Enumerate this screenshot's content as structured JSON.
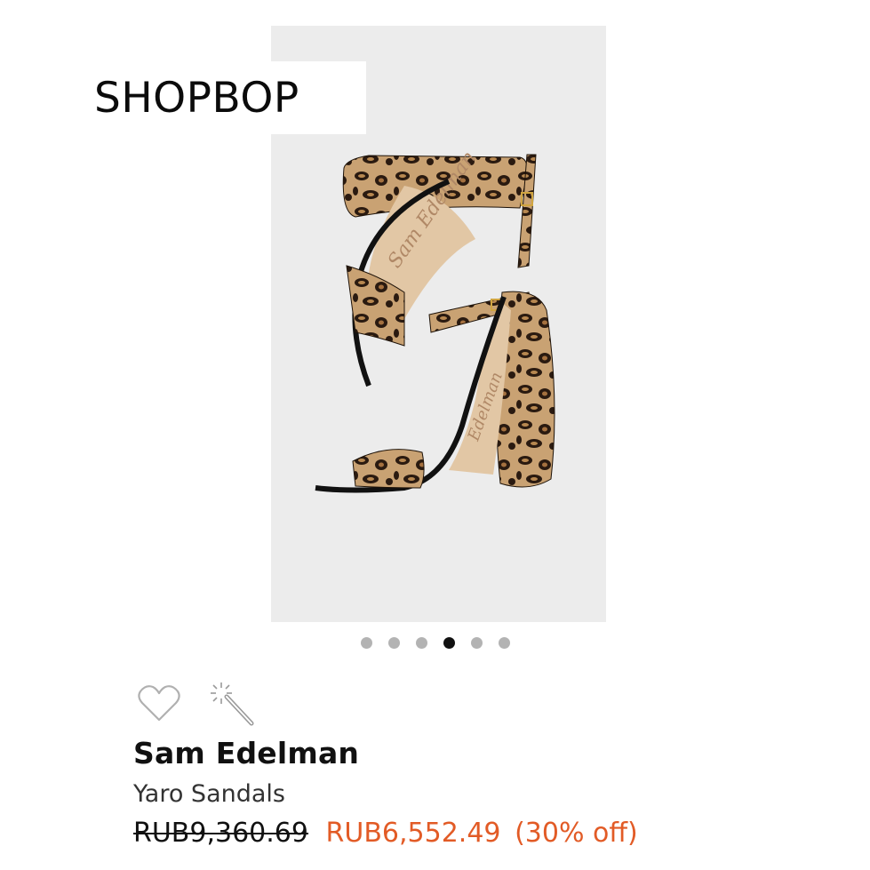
{
  "logo": "SHOPBOP",
  "gallery": {
    "dot_count": 6,
    "active_index": 3
  },
  "actions": {
    "favorite_icon": "heart-outline-icon",
    "tryon_icon": "magic-wand-icon"
  },
  "product": {
    "brand": "Sam Edelman",
    "name": "Yaro Sandals",
    "original_price": "RUB9,360.69",
    "sale_price": "RUB6,552.49",
    "discount": "(30% off)"
  },
  "colors": {
    "sale": "#e25b26",
    "photo_bg": "#ececec"
  }
}
